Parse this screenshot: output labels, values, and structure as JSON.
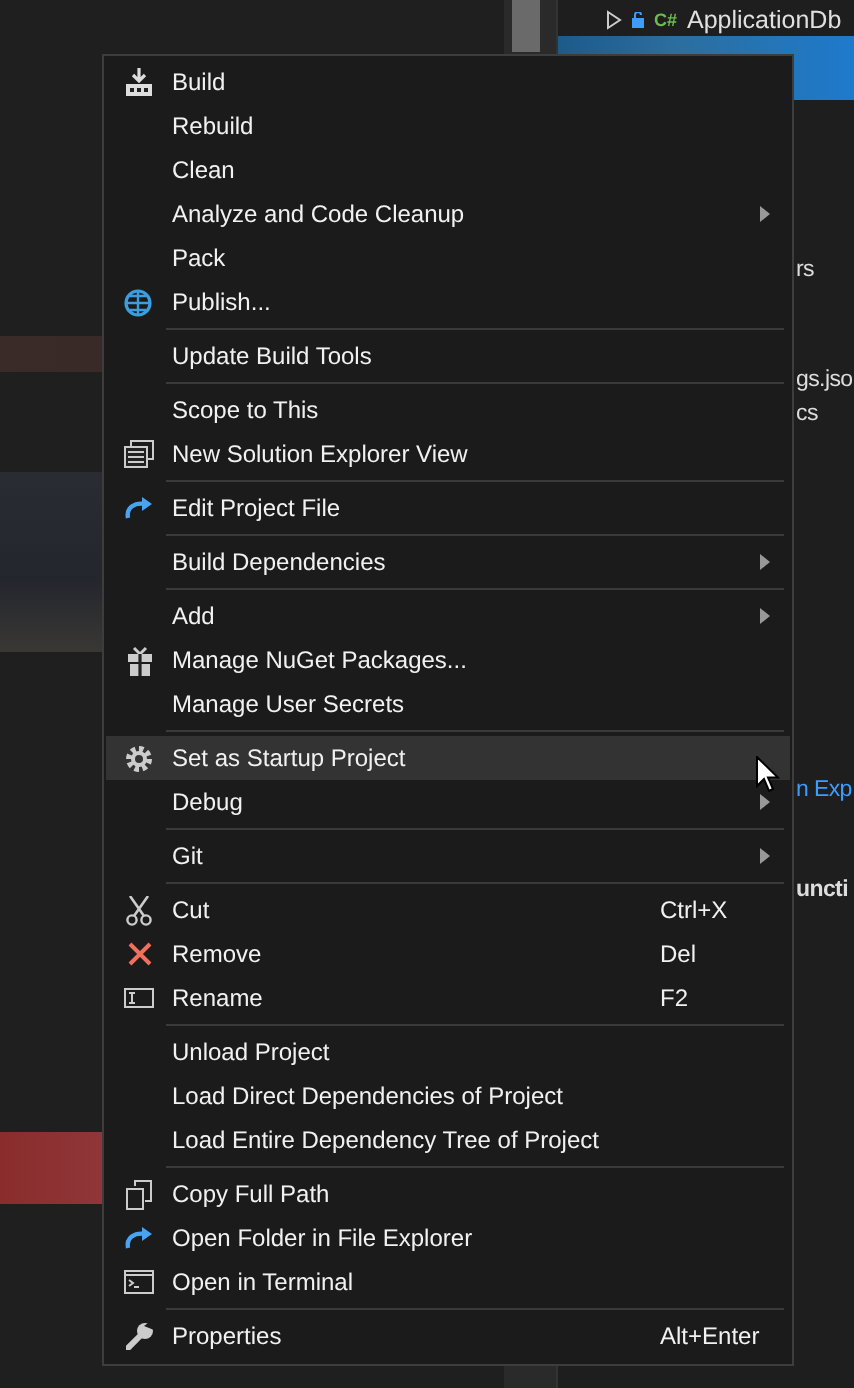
{
  "tree_item": {
    "label": "ApplicationDb",
    "language": "C#",
    "expanded": false
  },
  "side_fragments": [
    {
      "text": "rs",
      "kind": "plain"
    },
    {
      "text": "gs.jso",
      "kind": "plain"
    },
    {
      "text": "cs",
      "kind": "plain"
    },
    {
      "text": "n Exp",
      "kind": "link"
    },
    {
      "text": "uncti",
      "kind": "heading"
    }
  ],
  "context_menu": {
    "items": [
      {
        "kind": "item",
        "label": "Build",
        "submenu": false,
        "selected": false
      },
      {
        "kind": "item",
        "label": "Rebuild",
        "submenu": false,
        "selected": false
      },
      {
        "kind": "item",
        "label": "Clean",
        "submenu": false,
        "selected": false
      },
      {
        "kind": "item",
        "label": "Analyze and Code Cleanup",
        "submenu": true,
        "selected": false
      },
      {
        "kind": "item",
        "label": "Pack",
        "submenu": false,
        "selected": false
      },
      {
        "kind": "item",
        "label": "Publish...",
        "submenu": false,
        "selected": false
      },
      {
        "kind": "separator"
      },
      {
        "kind": "item",
        "label": "Update Build Tools",
        "submenu": false,
        "selected": false
      },
      {
        "kind": "separator"
      },
      {
        "kind": "item",
        "label": "Scope to This",
        "submenu": false,
        "selected": false
      },
      {
        "kind": "item",
        "label": "New Solution Explorer View",
        "submenu": false,
        "selected": false
      },
      {
        "kind": "separator"
      },
      {
        "kind": "item",
        "label": "Edit Project File",
        "submenu": false,
        "selected": false
      },
      {
        "kind": "separator"
      },
      {
        "kind": "item",
        "label": "Build Dependencies",
        "submenu": true,
        "selected": false
      },
      {
        "kind": "separator"
      },
      {
        "kind": "item",
        "label": "Add",
        "submenu": true,
        "selected": false
      },
      {
        "kind": "item",
        "label": "Manage NuGet Packages...",
        "submenu": false,
        "selected": false
      },
      {
        "kind": "item",
        "label": "Manage User Secrets",
        "submenu": false,
        "selected": false
      },
      {
        "kind": "separator"
      },
      {
        "kind": "item",
        "label": "Set as Startup Project",
        "submenu": false,
        "selected": true
      },
      {
        "kind": "item",
        "label": "Debug",
        "submenu": true,
        "selected": false
      },
      {
        "kind": "separator"
      },
      {
        "kind": "item",
        "label": "Git",
        "submenu": true,
        "selected": false
      },
      {
        "kind": "separator"
      },
      {
        "kind": "item",
        "label": "Cut",
        "shortcut": "Ctrl+X",
        "submenu": false,
        "selected": false
      },
      {
        "kind": "item",
        "label": "Remove",
        "shortcut": "Del",
        "submenu": false,
        "selected": false
      },
      {
        "kind": "item",
        "label": "Rename",
        "shortcut": "F2",
        "submenu": false,
        "selected": false
      },
      {
        "kind": "separator"
      },
      {
        "kind": "item",
        "label": "Unload Project",
        "submenu": false,
        "selected": false
      },
      {
        "kind": "item",
        "label": "Load Direct Dependencies of Project",
        "submenu": false,
        "selected": false
      },
      {
        "kind": "item",
        "label": "Load Entire Dependency Tree of Project",
        "submenu": false,
        "selected": false
      },
      {
        "kind": "separator"
      },
      {
        "kind": "item",
        "label": "Copy Full Path",
        "submenu": false,
        "selected": false
      },
      {
        "kind": "item",
        "label": "Open Folder in File Explorer",
        "submenu": false,
        "selected": false
      },
      {
        "kind": "item",
        "label": "Open in Terminal",
        "submenu": false,
        "selected": false
      },
      {
        "kind": "separator"
      },
      {
        "kind": "item",
        "label": "Properties",
        "shortcut": "Alt+Enter",
        "submenu": false,
        "selected": false
      }
    ]
  }
}
